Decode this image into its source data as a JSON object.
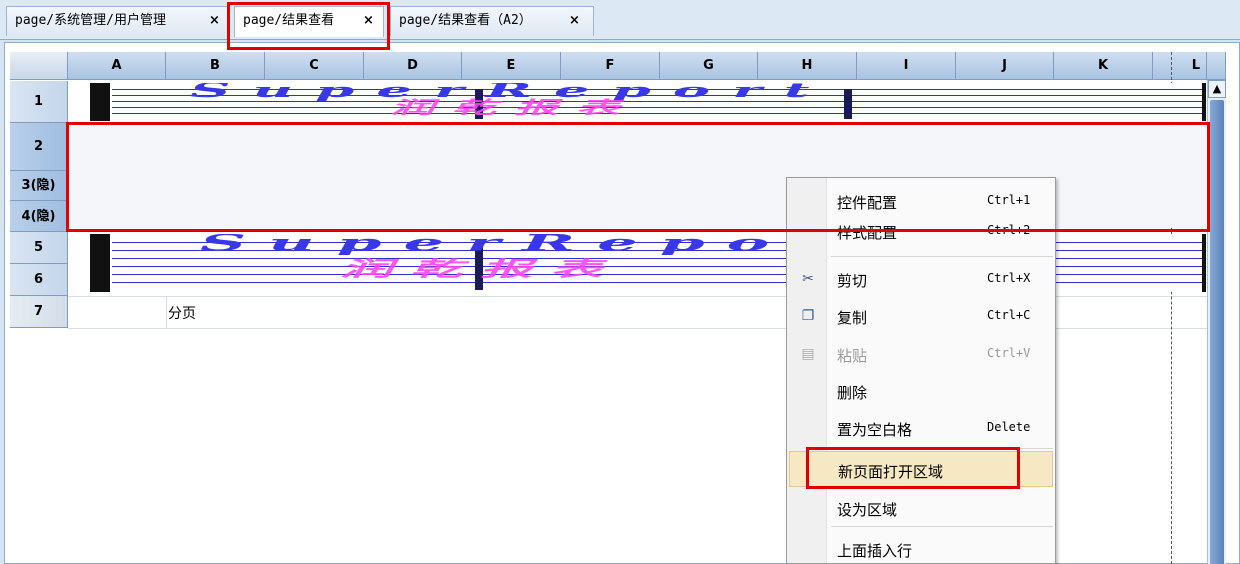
{
  "tabs": [
    {
      "label": "page/系统管理/用户管理",
      "close": "×"
    },
    {
      "label": "page/结果查看",
      "close": "×"
    },
    {
      "label": "page/结果查看（A2）",
      "close": "×"
    }
  ],
  "columns": [
    "A",
    "B",
    "C",
    "D",
    "E",
    "F",
    "G",
    "H",
    "I",
    "J",
    "K",
    "L"
  ],
  "rows": [
    "1",
    "2",
    "3(隐)",
    "4(隐)",
    "5",
    "6",
    "7"
  ],
  "cells": {
    "b7": "分页"
  },
  "watermark": {
    "blue": "SuperReport",
    "pink": "润乾报表"
  },
  "context_menu": {
    "items": [
      {
        "label": "控件配置",
        "shortcut": "Ctrl+1"
      },
      {
        "label": "样式配置",
        "shortcut": "Ctrl+2"
      },
      {
        "label": "剪切",
        "shortcut": "Ctrl+X",
        "icon": "scissors-icon"
      },
      {
        "label": "复制",
        "shortcut": "Ctrl+C",
        "icon": "copy-icon"
      },
      {
        "label": "粘贴",
        "shortcut": "Ctrl+V",
        "icon": "paste-icon"
      },
      {
        "label": "删除",
        "shortcut": ""
      },
      {
        "label": "置为空白格",
        "shortcut": "Delete"
      },
      {
        "label": "新页面打开区域",
        "shortcut": ""
      },
      {
        "label": "设为区域",
        "shortcut": ""
      },
      {
        "label": "上面插入行",
        "shortcut": ""
      }
    ]
  },
  "colors": {
    "highlight": "#e00000",
    "header": "#a9c4e3",
    "menu_hover": "#f7e8c4"
  }
}
